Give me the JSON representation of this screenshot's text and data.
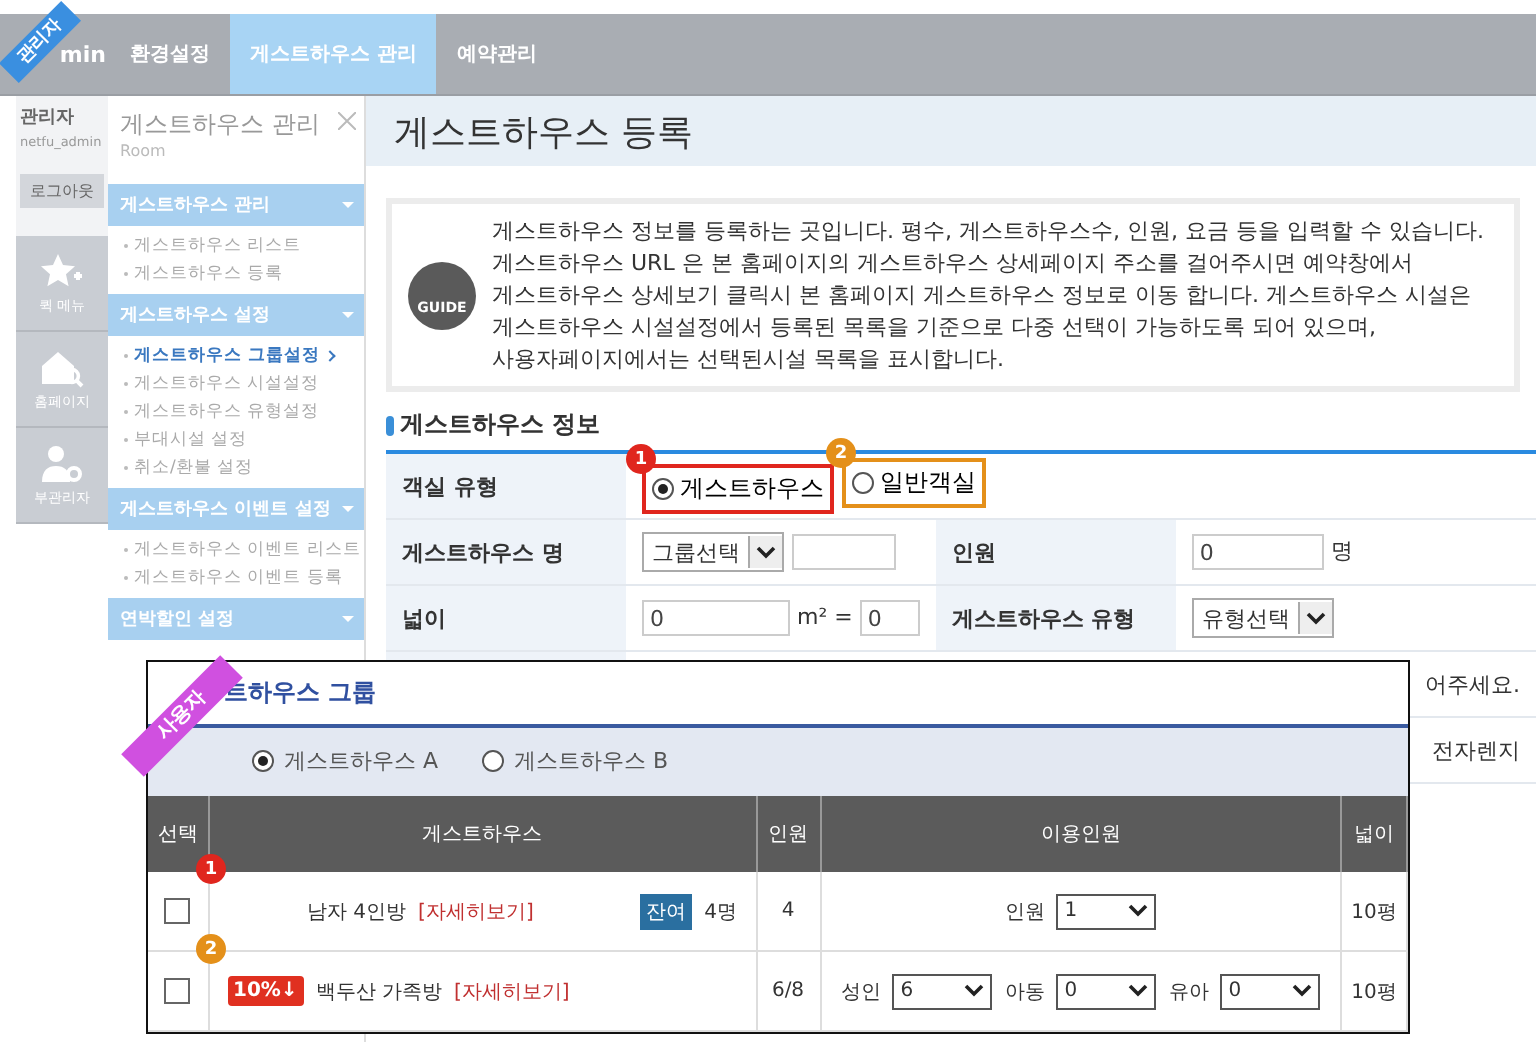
{
  "admin_ribbon": "관리자",
  "nav": {
    "brand": "min",
    "tabs": [
      {
        "label": "환경설정",
        "selected": false
      },
      {
        "label": "게스트하우스 관리",
        "selected": true
      },
      {
        "label": "예약관리",
        "selected": false
      }
    ]
  },
  "account": {
    "role": "관리자",
    "user_id": "netfu_admin",
    "logout": "로그아웃"
  },
  "quick_menu": [
    {
      "kind": "star",
      "label": "퀵 메뉴"
    },
    {
      "kind": "home",
      "label": "홈페이지"
    },
    {
      "kind": "admin",
      "label": "부관리자"
    }
  ],
  "sidebar": {
    "title": "게스트하우스 관리",
    "subtitle": "Room",
    "sections": [
      {
        "title": "게스트하우스 관리",
        "items": [
          {
            "label": "게스트하우스 리스트",
            "selected": false
          },
          {
            "label": "게스트하우스 등록",
            "selected": false
          }
        ]
      },
      {
        "title": "게스트하우스 설정",
        "items": [
          {
            "label": "게스트하우스 그룹설정",
            "selected": true
          },
          {
            "label": "게스트하우스 시설설정",
            "selected": false
          },
          {
            "label": "게스트하우스 유형설정",
            "selected": false
          },
          {
            "label": "부대시설 설정",
            "selected": false
          },
          {
            "label": "취소/환불 설정",
            "selected": false
          }
        ]
      },
      {
        "title": "게스트하우스 이벤트 설정",
        "items": [
          {
            "label": "게스트하우스 이벤트 리스트",
            "selected": false
          },
          {
            "label": "게스트하우스 이벤트 등록",
            "selected": false
          }
        ]
      },
      {
        "title": "연박할인 설정"
      }
    ]
  },
  "page_title": "게스트하우스 등록",
  "guide": {
    "badge": "GUIDE",
    "lines": [
      "게스트하우스 정보를 등록하는 곳입니다. 평수, 게스트하우스수, 인원, 요금 등을 입력할 수 있습니다.",
      "게스트하우스 URL 은 본 홈페이지의 게스트하우스 상세페이지 주소를 걸어주시면 예약창에서",
      "게스트하우스 상세보기 클릭시 본 홈페이지 게스트하우스 정보로 이동 합니다. 게스트하우스 시설은",
      "게스트하우스 시설설정에서 등록된 목록을 기준으로 다중 선택이 가능하도록 되어 있으며,",
      "사용자페이지에서는 선택된시설 목록을 표시합니다."
    ]
  },
  "section_title": "게스트하우스 정보",
  "form": {
    "room_type": {
      "label": "객실 유형",
      "options": [
        {
          "label": "게스트하우스",
          "selected": true,
          "marker": "1",
          "color": "#e0261e"
        },
        {
          "label": "일반객실",
          "selected": false,
          "marker": "2",
          "color": "#e4901a"
        }
      ]
    },
    "name": {
      "label": "게스트하우스 명",
      "select": "그룹선택"
    },
    "capacity": {
      "label": "인원",
      "value": "0",
      "unit": "명"
    },
    "area": {
      "label": "넓이",
      "value": "0",
      "unit": "m²",
      "equals": "=",
      "converted": "0"
    },
    "type": {
      "label": "게스트하우스 유형",
      "select": "유형선택"
    },
    "covered_rows": [
      "어주세요.",
      "전자렌지"
    ]
  },
  "user_ribbon": "사용자",
  "popup": {
    "title": "트하우스 그룹",
    "filters": [
      {
        "label": "게스트하우스 A",
        "selected": true
      },
      {
        "label": "게스트하우스 B",
        "selected": false
      }
    ],
    "columns": [
      "선택",
      "게스트하우스",
      "인원",
      "이용인원",
      "넓이"
    ],
    "rows": [
      {
        "marker": "1",
        "color": "#e0261e",
        "checked": false,
        "name": "남자 4인방",
        "link": "[자세히보기]",
        "remain_badge": "잔여",
        "remain": "4명",
        "capacity": "4",
        "guests": [
          {
            "label": "인원",
            "value": "1"
          }
        ],
        "area": "10평"
      },
      {
        "marker": "2",
        "color": "#e4901a",
        "checked": false,
        "discount": "10%↓",
        "name": "백두산 가족방",
        "link": "[자세히보기]",
        "capacity": "6/8",
        "guests": [
          {
            "label": "성인",
            "value": "6"
          },
          {
            "label": "아동",
            "value": "0"
          },
          {
            "label": "유아",
            "value": "0"
          }
        ],
        "area": "10평"
      }
    ]
  }
}
